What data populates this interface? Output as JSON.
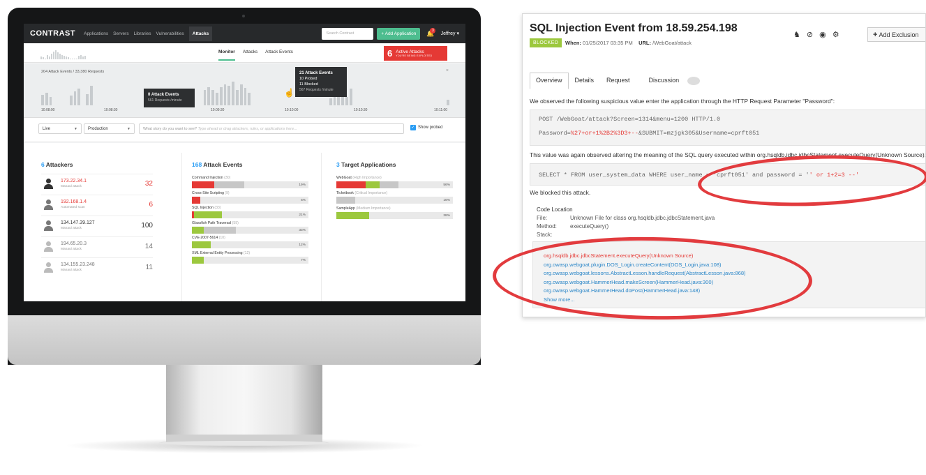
{
  "dashboard": {
    "logo": "CONTRAST",
    "nav": [
      "Applications",
      "Servers",
      "Libraries",
      "Vulnerabilities",
      "Attacks"
    ],
    "search_placeholder": "Search Contrast",
    "add_application": "+ Add Application",
    "notification_count": "3",
    "user": "Jeffrey",
    "subtabs": [
      "Monitor",
      "Attacks",
      "Attack Events"
    ],
    "active_attacks": {
      "count": "6",
      "label": "Active Attacks",
      "sub": "YOU'RE BEING EXPLOITED"
    },
    "timeline": {
      "summary": "204 Attack Events / 33,380 Requests",
      "ticks": [
        "10:08:00",
        "10:08:30",
        "10:09:30",
        "10:10:00",
        "10:10:30",
        "10:11:00"
      ],
      "tooltip_left": {
        "title": "0 Attack Events",
        "sub": "561 Requests /minute"
      },
      "tooltip_right": {
        "title": "21 Attack Events",
        "line1": "10 Probed",
        "line2": "11 Blocked",
        "sub": "567 Requests /minute"
      }
    },
    "filters": {
      "mode": "Live",
      "environment": "Production",
      "story_prompt": "What story do you want to see?",
      "story_hint": "Type ahead or drag attackers, rules, or applications here...",
      "show_probed": "Show probed"
    },
    "attackers": {
      "count": "6",
      "title": "Attackers",
      "items": [
        {
          "ip": "173.22.34.1",
          "type": "Manaul attack",
          "count": "32",
          "color": "#e53935"
        },
        {
          "ip": "192.168.1.4",
          "type": "Automated scan",
          "count": "6",
          "color": "#e53935"
        },
        {
          "ip": "134.147.39.127",
          "type": "Manaul attack",
          "count": "100",
          "color": "#333333"
        },
        {
          "ip": "194.65.20.3",
          "type": "Manaul attack",
          "count": "14",
          "color": "#777777"
        },
        {
          "ip": "134.155.23.248",
          "type": "Manaul attack",
          "count": "11",
          "color": "#777777"
        }
      ]
    },
    "attack_events": {
      "count": "168",
      "title": "Attack Events",
      "items": [
        {
          "name": "Command Injection",
          "n": "(30)",
          "pct": "19%",
          "red": 0.19,
          "green": 0,
          "gray": 0.26
        },
        {
          "name": "Cross-Site Scripting",
          "n": "(9)",
          "pct": "5%",
          "red": 0.07,
          "green": 0,
          "gray": 0
        },
        {
          "name": "SQL Injection",
          "n": "(33)",
          "pct": "21%",
          "red": 0.02,
          "green": 0.24,
          "gray": 0
        },
        {
          "name": "Glassfish Path Traversal",
          "n": "(59)",
          "pct": "33%",
          "red": 0,
          "green": 0.1,
          "gray": 0.28
        },
        {
          "name": "CVE-2007-5614",
          "n": "(10)",
          "pct": "12%",
          "red": 0,
          "green": 0.16,
          "gray": 0
        },
        {
          "name": "XML External Entity Processing",
          "n": "(12)",
          "pct": "7%",
          "red": 0,
          "green": 0.1,
          "gray": 0
        }
      ]
    },
    "target_apps": {
      "count": "3",
      "title": "Target Applications",
      "items": [
        {
          "name": "WebGoat",
          "importance": "(High Importance)",
          "pct": "56%",
          "red": 0.25,
          "green": 0.12,
          "gray": 0.16
        },
        {
          "name": "Ticketbook",
          "importance": "(Critical Importance)",
          "pct": "16%",
          "red": 0,
          "green": 0,
          "gray": 0.16
        },
        {
          "name": "SampleApp",
          "importance": "(Medium Importance)",
          "pct": "28%",
          "red": 0,
          "green": 0.28,
          "gray": 0
        }
      ]
    }
  },
  "event": {
    "title": "SQL Injection Event from 18.59.254.198",
    "status": "BLOCKED",
    "when_label": "When:",
    "when": "01/25/2017 03:35 PM",
    "url_label": "URL:",
    "url": "/WebGoat/attack",
    "add_exclusion": "Add Exclusion",
    "tabs": [
      "Overview",
      "Details",
      "Request",
      "Discussion"
    ],
    "observed_text": "We observed the following suspicious value enter the application through the HTTP Request Parameter \"Password\":",
    "request_line": "POST /WebGoat/attack?Screen=1314&menu=1200 HTTP/1.0",
    "password_prefix": "Password=",
    "password_value": "%27+or+1%2B2%3D3+--",
    "password_suffix": "&SUBMIT=mzjgk305&Username=cprft051",
    "altered_text": "This value was again observed altering the meaning of the SQL query executed within org.hsqldb.jdbc.jdbcStatement.executeQuery(Unknown Source):",
    "sql_prefix": "SELECT * FROM user_system_data WHERE user_name = 'cprft051' and password = '",
    "sql_inject": "' or 1+2=3 --'",
    "blocked_text": "We blocked this attack.",
    "code_location": "Code Location",
    "file_label": "File:",
    "file": "Unknown File for class org.hsqldb.jdbc.jdbcStatement.java",
    "method_label": "Method:",
    "method": "executeQuery()",
    "stack_label": "Stack:",
    "stack": [
      "org.hsqldb.jdbc.jdbcStatement.executeQuery(Unknown Source)",
      "org.owasp.webgoat.plugin.DOS_Login.createContent(DOS_Login.java:108)",
      "org.owasp.webgoat.lessons.AbstractLesson.handleRequest(AbstractLesson.java:868)",
      "org.owasp.webgoat.HammerHead.makeScreen(HammerHead.java:300)",
      "org.owasp.webgoat.HammerHead.doPost(HammerHead.java:148)"
    ],
    "show_more": "Show more..."
  },
  "colors": {
    "red": "#e53935",
    "green": "#9cc83e",
    "gray": "#c7c7c7",
    "blue": "#2a86c8",
    "annotation": "#e23b3e"
  }
}
